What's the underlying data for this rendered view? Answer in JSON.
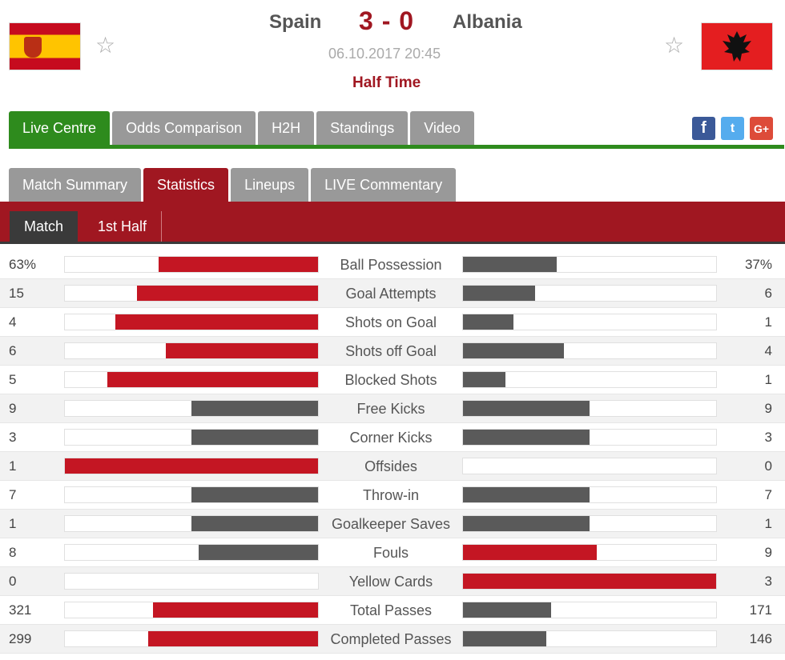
{
  "header": {
    "home_team": "Spain",
    "away_team": "Albania",
    "score": "3 - 0",
    "datetime": "06.10.2017 20:45",
    "status": "Half Time"
  },
  "main_tabs": [
    "Live Centre",
    "Odds Comparison",
    "H2H",
    "Standings",
    "Video"
  ],
  "social": {
    "facebook": "f",
    "twitter": "t",
    "google_plus": "G+"
  },
  "sub_tabs": [
    "Match Summary",
    "Statistics",
    "Lineups",
    "LIVE Commentary"
  ],
  "period_tabs": [
    "Match",
    "1st Half"
  ],
  "colors": {
    "accent_red": "#a01721",
    "green": "#2e8b1d",
    "bar_red": "#c41623",
    "bar_grey": "#5a5a5a"
  },
  "stats": [
    {
      "label": "Ball Possession",
      "home": "63%",
      "away": "37%",
      "home_num": 63,
      "away_num": 37
    },
    {
      "label": "Goal Attempts",
      "home": "15",
      "away": "6",
      "home_num": 15,
      "away_num": 6
    },
    {
      "label": "Shots on Goal",
      "home": "4",
      "away": "1",
      "home_num": 4,
      "away_num": 1
    },
    {
      "label": "Shots off Goal",
      "home": "6",
      "away": "4",
      "home_num": 6,
      "away_num": 4
    },
    {
      "label": "Blocked Shots",
      "home": "5",
      "away": "1",
      "home_num": 5,
      "away_num": 1
    },
    {
      "label": "Free Kicks",
      "home": "9",
      "away": "9",
      "home_num": 9,
      "away_num": 9
    },
    {
      "label": "Corner Kicks",
      "home": "3",
      "away": "3",
      "home_num": 3,
      "away_num": 3
    },
    {
      "label": "Offsides",
      "home": "1",
      "away": "0",
      "home_num": 1,
      "away_num": 0
    },
    {
      "label": "Throw-in",
      "home": "7",
      "away": "7",
      "home_num": 7,
      "away_num": 7
    },
    {
      "label": "Goalkeeper Saves",
      "home": "1",
      "away": "1",
      "home_num": 1,
      "away_num": 1
    },
    {
      "label": "Fouls",
      "home": "8",
      "away": "9",
      "home_num": 8,
      "away_num": 9
    },
    {
      "label": "Yellow Cards",
      "home": "0",
      "away": "3",
      "home_num": 0,
      "away_num": 3
    },
    {
      "label": "Total Passes",
      "home": "321",
      "away": "171",
      "home_num": 321,
      "away_num": 171
    },
    {
      "label": "Completed Passes",
      "home": "299",
      "away": "146",
      "home_num": 299,
      "away_num": 146
    }
  ]
}
